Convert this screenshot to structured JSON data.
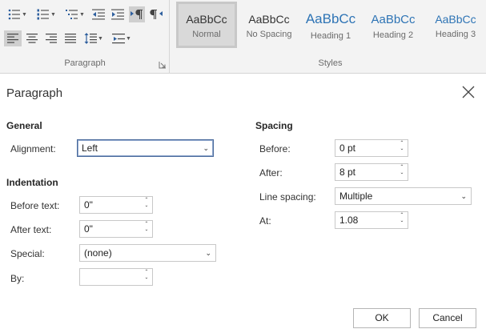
{
  "ribbon": {
    "paragraph_group_label": "Paragraph",
    "styles_group_label": "Styles",
    "styles": [
      {
        "sample": "AaBbCc",
        "name": "Normal"
      },
      {
        "sample": "AaBbCc",
        "name": "No Spacing"
      },
      {
        "sample": "AaBbCc",
        "name": "Heading 1"
      },
      {
        "sample": "AaBbCc",
        "name": "Heading 2"
      },
      {
        "sample": "AaBbCc",
        "name": "Heading 3"
      }
    ]
  },
  "dialog": {
    "title": "Paragraph",
    "general": {
      "heading": "General",
      "alignment_label": "Alignment:",
      "alignment_value": "Left"
    },
    "indentation": {
      "heading": "Indentation",
      "before_label": "Before text:",
      "before_value": "0\"",
      "after_label": "After text:",
      "after_value": "0\"",
      "special_label": "Special:",
      "special_value": "(none)",
      "by_label": "By:",
      "by_value": ""
    },
    "spacing": {
      "heading": "Spacing",
      "before_label": "Before:",
      "before_value": "0 pt",
      "after_label": "After:",
      "after_value": "8 pt",
      "line_spacing_label": "Line spacing:",
      "line_spacing_value": "Multiple",
      "at_label": "At:",
      "at_value": "1.08"
    },
    "buttons": {
      "ok": "OK",
      "cancel": "Cancel"
    }
  }
}
